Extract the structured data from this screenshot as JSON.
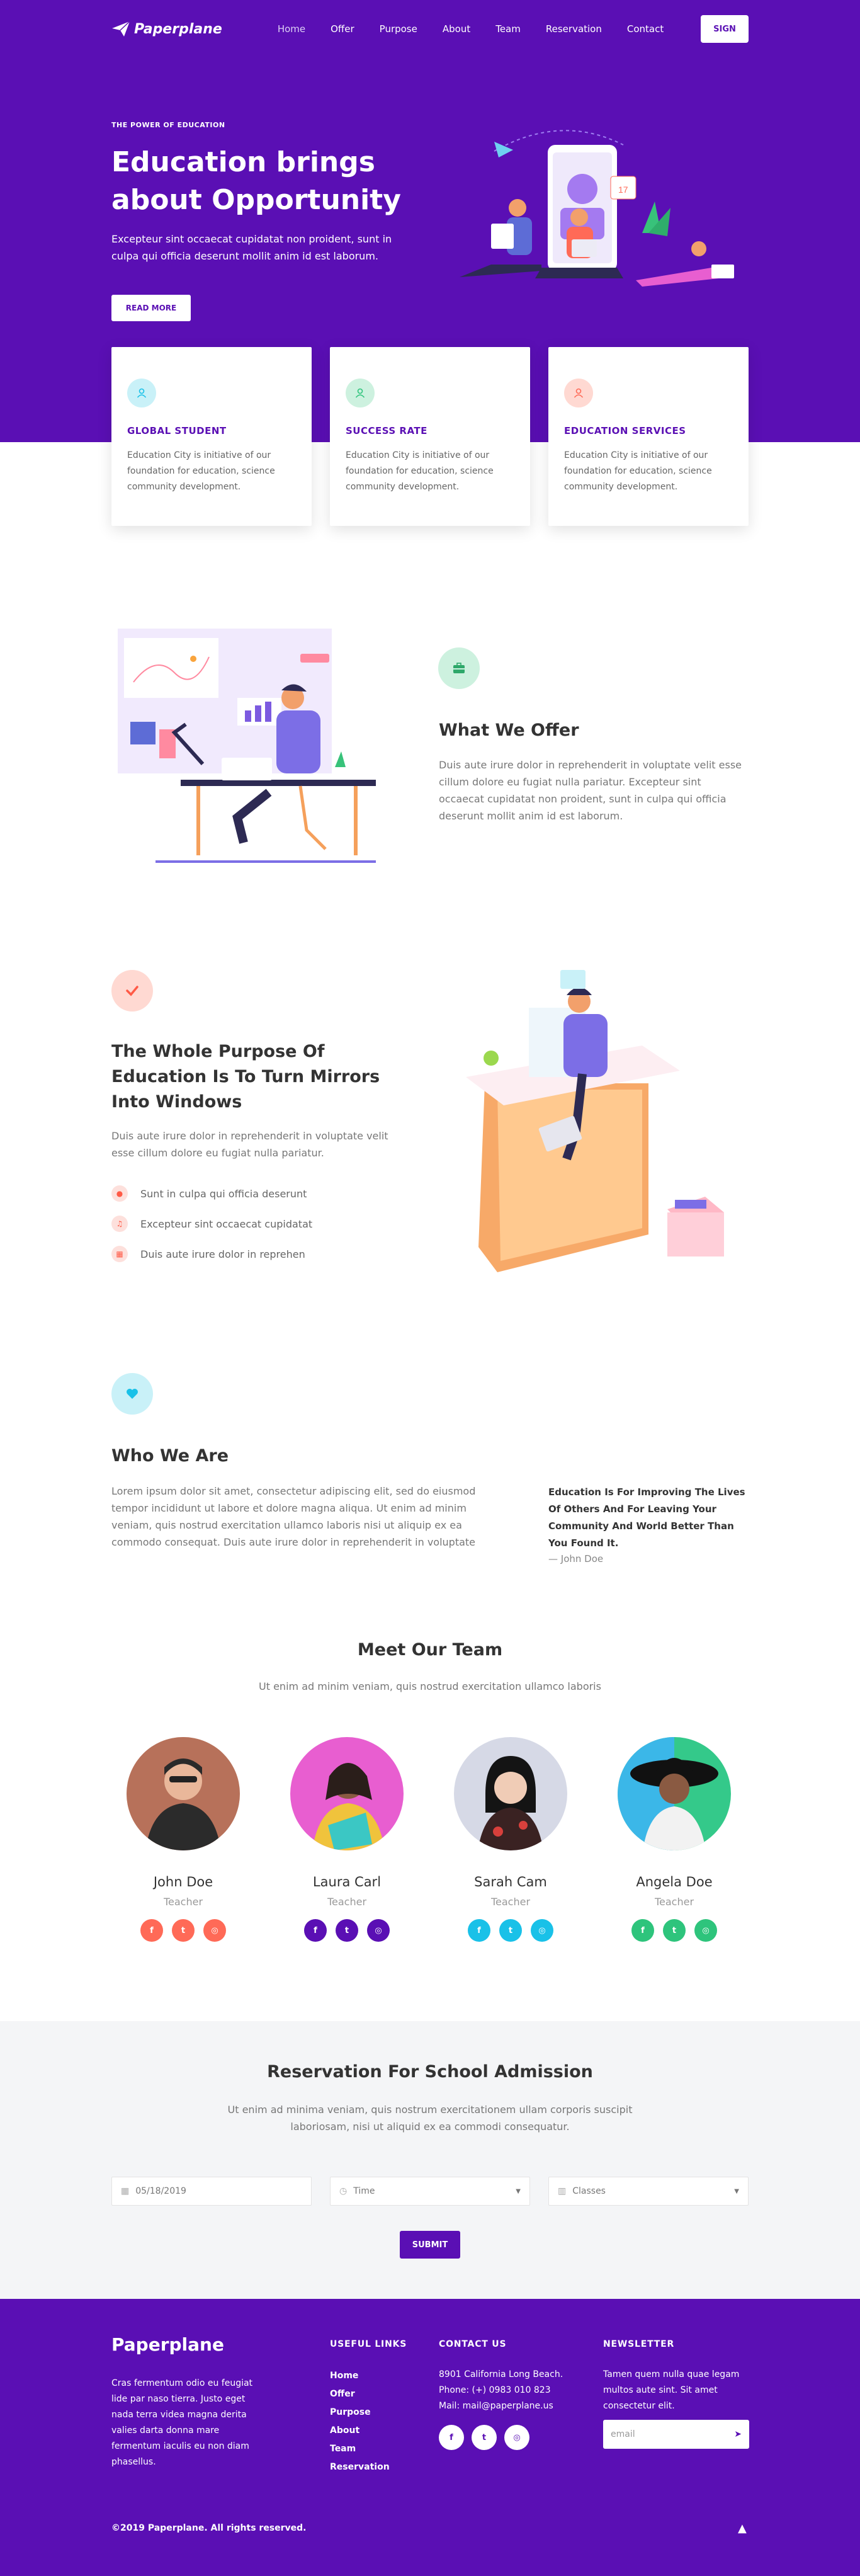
{
  "nav": {
    "logo": "Paperplane",
    "items": [
      "Home",
      "Offer",
      "Purpose",
      "About",
      "Team",
      "Reservation",
      "Contact"
    ],
    "active": "Home",
    "sign_label": "SIGN"
  },
  "hero": {
    "eyebrow": "THE POWER OF EDUCATION",
    "title": "Education brings about Opportunity",
    "text": "Excepteur sint occaecat cupidatat non proident, sunt in culpa qui officia deserunt mollit anim id est laborum.",
    "button": "READ MORE"
  },
  "cards": [
    {
      "title": "GLOBAL STUDENT",
      "text": "Education City is initiative of our foundation for education, science community development.",
      "icon_color": "#19c1e8",
      "icon_bg": "#c9f1f8"
    },
    {
      "title": "SUCCESS RATE",
      "text": "Education City is initiative of our foundation for education, science community development.",
      "icon_color": "#2ec47c",
      "icon_bg": "#cdf1df"
    },
    {
      "title": "EDUCATION SERVICES",
      "text": "Education City is initiative of our foundation for education, science community development.",
      "icon_color": "#ff6a57",
      "icon_bg": "#ffd9d2"
    }
  ],
  "offer": {
    "title": "What We Offer",
    "text": "Duis aute irure dolor in reprehenderit in voluptate velit esse cillum dolore eu fugiat nulla pariatur. Excepteur sint occaecat cupidatat non proident, sunt in culpa qui officia deserunt mollit anim id est laborum."
  },
  "purpose": {
    "title": "The Whole Purpose Of Education Is To Turn Mirrors Into Windows",
    "text": "Duis aute irure dolor in reprehenderit in voluptate velit esse cillum dolore eu fugiat nulla pariatur.",
    "bullets": [
      "Sunt in culpa qui officia deserunt",
      "Excepteur sint occaecat cupidatat",
      "Duis aute irure dolor in reprehen"
    ]
  },
  "about": {
    "title": "Who We Are",
    "text": "Lorem ipsum dolor sit amet, consectetur adipiscing elit, sed do eiusmod tempor incididunt ut labore et dolore magna aliqua. Ut enim ad minim veniam, quis nostrud exercitation ullamco laboris nisi ut aliquip ex ea commodo consequat. Duis aute irure dolor in reprehenderit in voluptate",
    "quote": "Education Is For Improving The Lives Of Others And For Leaving Your Community And World Better Than You Found It.",
    "quote_author": "— John Doe"
  },
  "team": {
    "title": "Meet Our Team",
    "subtitle": "Ut enim ad minim veniam, quis nostrud exercitation ullamco laboris",
    "members": [
      {
        "name": "John Doe",
        "role": "Teacher",
        "ring": "#ff6a57",
        "social": "#ff6a57"
      },
      {
        "name": "Laura Carl",
        "role": "Teacher",
        "ring": "#e85ed0",
        "social": "#5a0fb4"
      },
      {
        "name": "Sarah Cam",
        "role": "Teacher",
        "ring": "#d6d9e6",
        "social": "#19c1e8"
      },
      {
        "name": "Angela Doe",
        "role": "Teacher",
        "ring": "#34c98a",
        "social": "#2ec47c"
      }
    ],
    "social_glyphs": [
      "f",
      "t",
      "◎"
    ]
  },
  "reservation": {
    "title": "Reservation For School Admission",
    "text": "Ut enim ad minima veniam, quis nostrum exercitationem ullam corporis suscipit laboriosam, nisi ut aliquid ex ea commodi consequatur.",
    "date_value": "05/18/2019",
    "time_placeholder": "Time",
    "classes_placeholder": "Classes",
    "submit": "SUBMIT"
  },
  "footer": {
    "brand": "Paperplane",
    "text": "Cras fermentum odio eu feugiat lide par naso tierra. Justo eget nada terra videa magna derita valies darta donna mare fermentum iaculis eu non diam phasellus.",
    "links_heading": "USEFUL LINKS",
    "links": [
      "Home",
      "Offer",
      "Purpose",
      "About",
      "Team",
      "Reservation"
    ],
    "contact_heading": "CONTACT US",
    "address": "8901 California Long Beach.",
    "phone": "Phone: (+) 0983 010 823",
    "mail": "Mail: mail@paperplane.us",
    "newsletter_heading": "NEWSLETTER",
    "newsletter_text": "Tamen quem nulla quae legam multos aute sint. Sit amet consectetur elit.",
    "email_placeholder": "email",
    "copyright": "©2019 Paperplane. All rights reserved."
  }
}
